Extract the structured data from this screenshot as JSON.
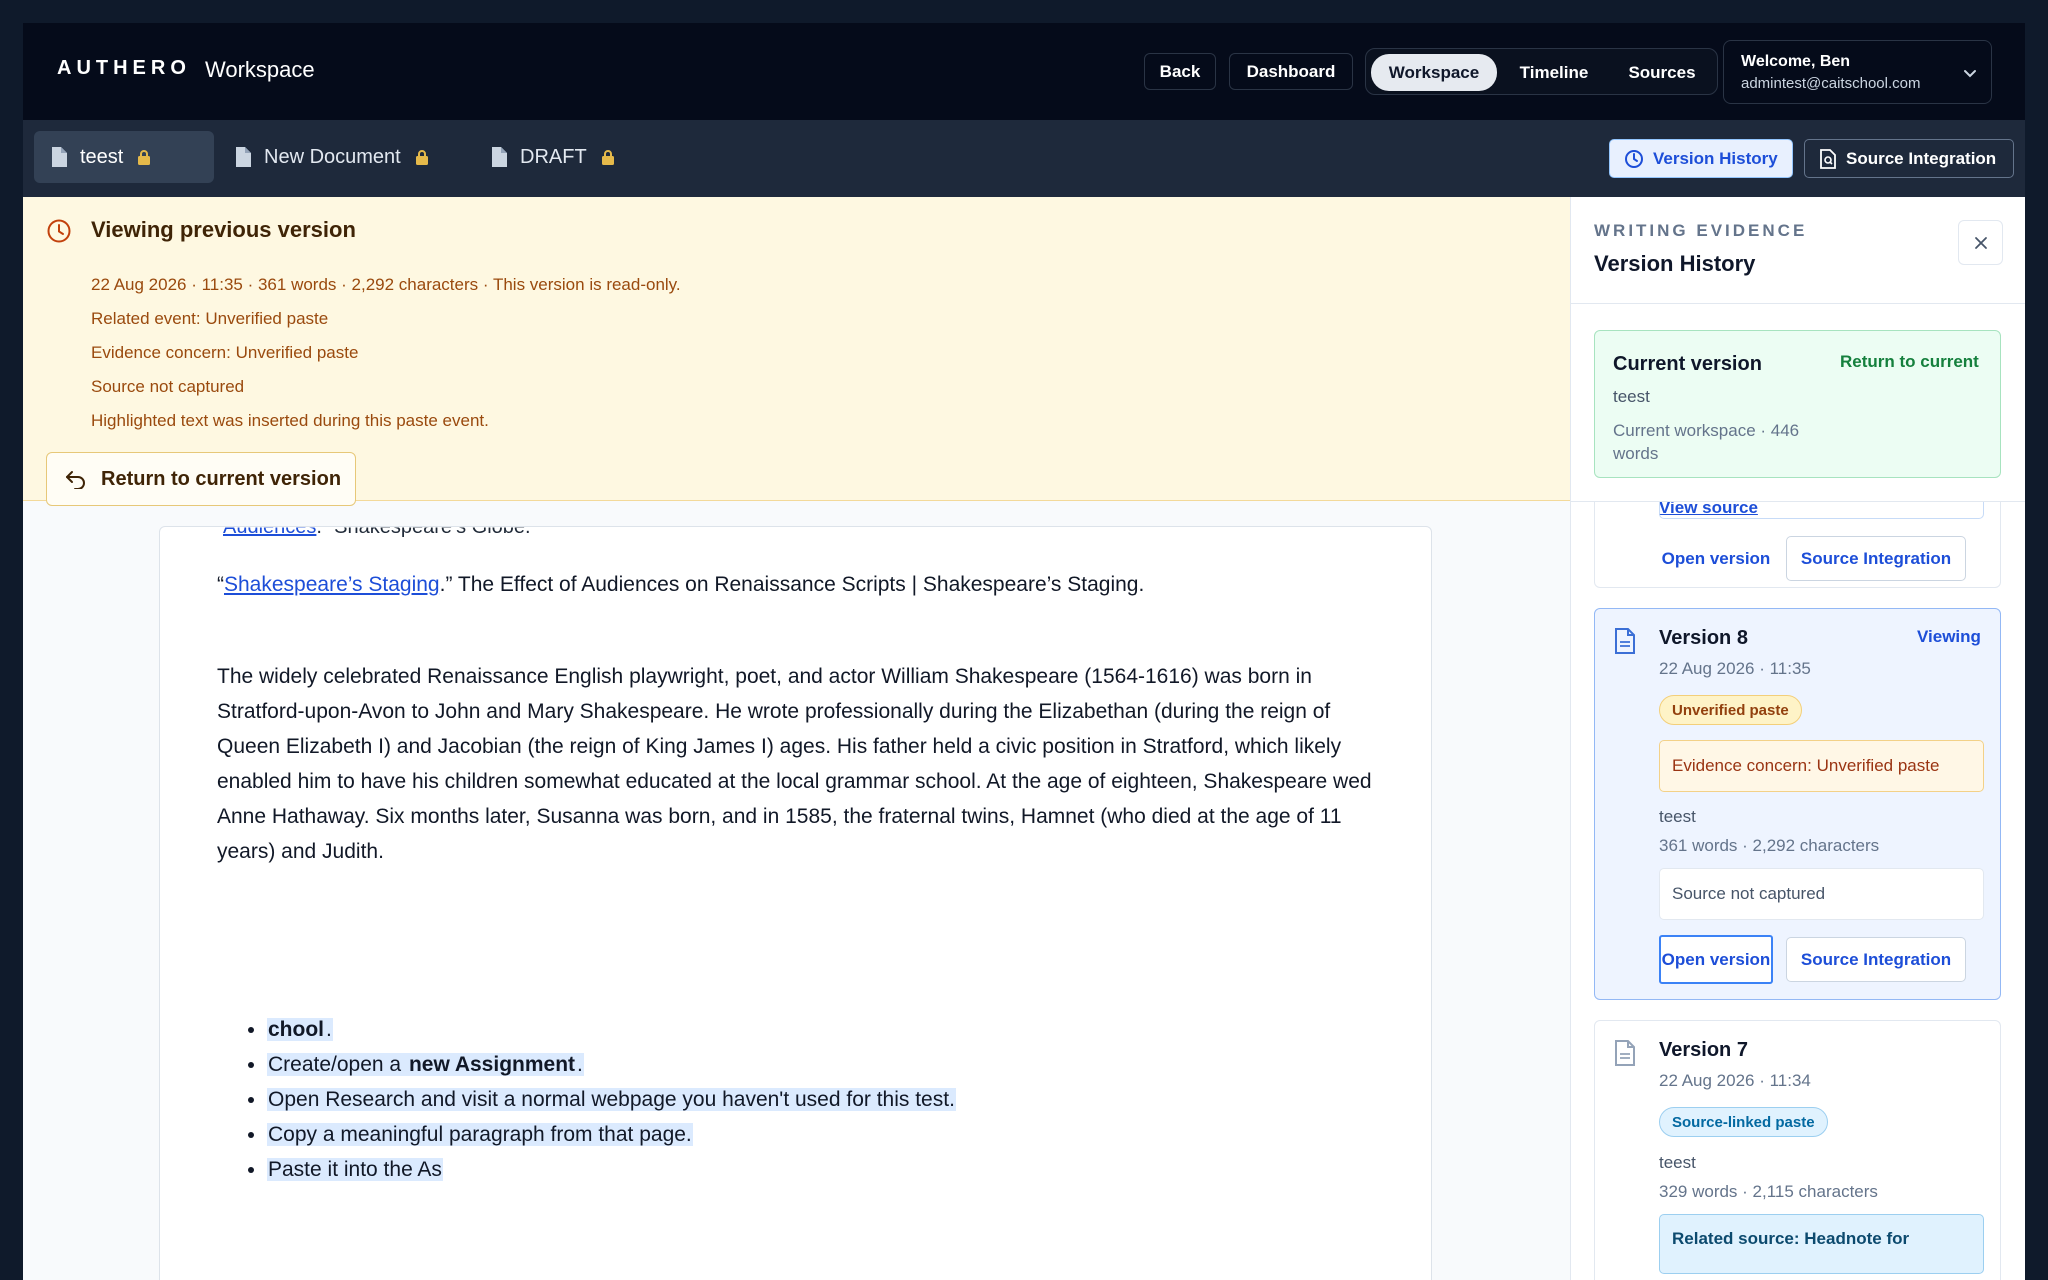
{
  "header": {
    "logo": "AUTHERO",
    "title": "Workspace",
    "back_label": "Back",
    "dashboard_label": "Dashboard",
    "nav_tabs": [
      {
        "label": "Workspace",
        "active": true
      },
      {
        "label": "Timeline",
        "active": false
      },
      {
        "label": "Sources",
        "active": false
      }
    ],
    "user_name": "Welcome, Ben",
    "user_email": "admintest@caitschool.com"
  },
  "doc_tabs": [
    {
      "label": "teest",
      "active": true
    },
    {
      "label": "New Document",
      "active": false
    },
    {
      "label": "DRAFT",
      "active": false
    }
  ],
  "toolbar": {
    "version_history_label": "Version History",
    "source_integration_label": "Source Integration"
  },
  "notice": {
    "title": "Viewing previous version",
    "meta": "22 Aug 2026 · 11:35 · 361 words · 2,292 characters · This version is read-only.",
    "lines": [
      "Related event: Unverified paste",
      "Evidence concern: Unverified paste",
      "Source not captured",
      "Highlighted text was inserted during this paste event."
    ],
    "return_label": "Return to current version"
  },
  "document": {
    "clipped_line_link": "Audiences",
    "clipped_line_rest": ".” Shakespeare’s Globe.",
    "citation_open": "“",
    "citation_link": "Shakespeare’s Staging",
    "citation_rest": ".” The Effect of Audiences on Renaissance Scripts | Shakespeare’s Staging.",
    "paragraph": "The widely celebrated Renaissance English playwright, poet, and actor William Shakespeare (1564-1616) was born in Stratford-upon-Avon to John and Mary Shakespeare. He wrote professionally during the Elizabethan (during the reign of Queen Elizabeth I) and Jacobian (the reign of King James I) ages. His father held a civic position in Stratford, which likely enabled him to have his children somewhat educated at the local grammar school. At the age of eighteen, Shakespeare wed Anne Hathaway. Six months later, Susanna was born, and in 1585, the fraternal twins, Hamnet (who died at the age of 11 years) and Judith.",
    "bullets": {
      "b1_bold": "chool",
      "b1_end": ".",
      "b2_pre": "Create/open a ",
      "b2_bold": "new Assignment",
      "b2_end": ".",
      "b3": "Open Research and visit a normal webpage you haven't used for this test.",
      "b4": "Copy a meaningful paragraph from that page.",
      "b5": "Paste it into the As"
    }
  },
  "sidebar": {
    "kicker": "WRITING EVIDENCE",
    "title": "Version History",
    "current": {
      "title": "Current version",
      "return_label": "Return to current",
      "name": "teest",
      "meta": "Current workspace · 446 words"
    },
    "partial_card": {
      "view_source": "View source",
      "open_label": "Open version",
      "source_label": "Source Integration"
    },
    "version8": {
      "title": "Version 8",
      "status": "Viewing",
      "date": "22 Aug 2026 · 11:35",
      "badge": "Unverified paste",
      "concern": "Evidence concern: Unverified paste",
      "name": "teest",
      "meta": "361 words · 2,292 characters",
      "source": "Source not captured",
      "open_label": "Open version",
      "source_label": "Source Integration"
    },
    "version7": {
      "title": "Version 7",
      "date": "22 Aug 2026 · 11:34",
      "badge": "Source-linked paste",
      "name": "teest",
      "meta": "329 words · 2,115 characters",
      "related": "Related source: Headnote for"
    }
  }
}
